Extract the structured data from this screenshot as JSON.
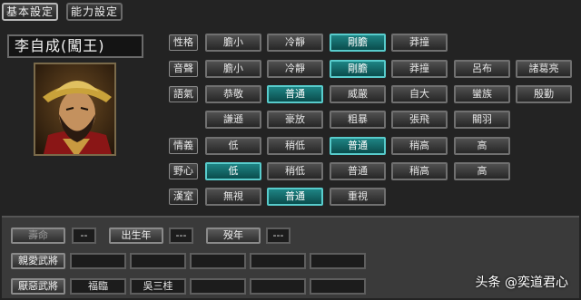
{
  "tabs": [
    "基本設定",
    "能力設定"
  ],
  "officer": {
    "name": "李自成(闖王)"
  },
  "attributes": {
    "性格": {
      "label": "性格",
      "options": [
        "膽小",
        "冷靜",
        "剛膽",
        "莽撞"
      ],
      "selected": 2
    },
    "音聲": {
      "label": "音聲",
      "options": [
        "膽小",
        "冷靜",
        "剛膽",
        "莽撞",
        "呂布",
        "諸葛亮"
      ],
      "selected": 2
    },
    "語氣": {
      "label": "語氣",
      "options": [
        "恭敬",
        "普通",
        "威嚴",
        "自大",
        "蠻族",
        "殷勤",
        "謙遜",
        "豪放",
        "粗暴",
        "張飛",
        "關羽"
      ],
      "selected": 1
    },
    "情義": {
      "label": "情義",
      "options": [
        "低",
        "稍低",
        "普通",
        "稍高",
        "高"
      ],
      "selected": 2
    },
    "野心": {
      "label": "野心",
      "options": [
        "低",
        "稍低",
        "普通",
        "稍高",
        "高"
      ],
      "selected": 0
    },
    "漢室": {
      "label": "漢室",
      "options": [
        "無視",
        "普通",
        "重視"
      ],
      "selected": 1
    }
  },
  "fields": {
    "lifespan_label": "壽命",
    "lifespan_value": "--",
    "birth_label": "出生年",
    "birth_value": "---",
    "death_label": "歿年",
    "death_value": "---",
    "liked_label": "親愛武將",
    "liked": [
      "",
      "",
      "",
      "",
      ""
    ],
    "disliked_label": "厭惡武將",
    "disliked": [
      "福臨",
      "吳三桂",
      "",
      "",
      ""
    ]
  },
  "watermark": "头条 @奕道君心"
}
